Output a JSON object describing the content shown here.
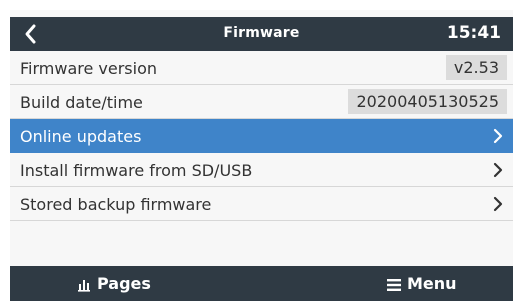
{
  "header": {
    "title": "Firmware",
    "time": "15:41"
  },
  "rows": [
    {
      "label": "Firmware version",
      "value": "v2.53"
    },
    {
      "label": "Build date/time",
      "value": "20200405130525"
    },
    {
      "label": "Online updates",
      "selected": true
    },
    {
      "label": "Install firmware from SD/USB"
    },
    {
      "label": "Stored backup firmware"
    }
  ],
  "footer": {
    "pages_label": "Pages",
    "menu_label": "Menu"
  },
  "colors": {
    "header_bg": "#2f3a44",
    "selected_bg": "#3f84c9",
    "value_box_bg": "#dcdcdc"
  },
  "icons": {
    "back": "chevron-left-icon",
    "row_arrow": "chevron-right-icon",
    "pages": "bar-chart-icon",
    "menu": "hamburger-menu-icon"
  }
}
